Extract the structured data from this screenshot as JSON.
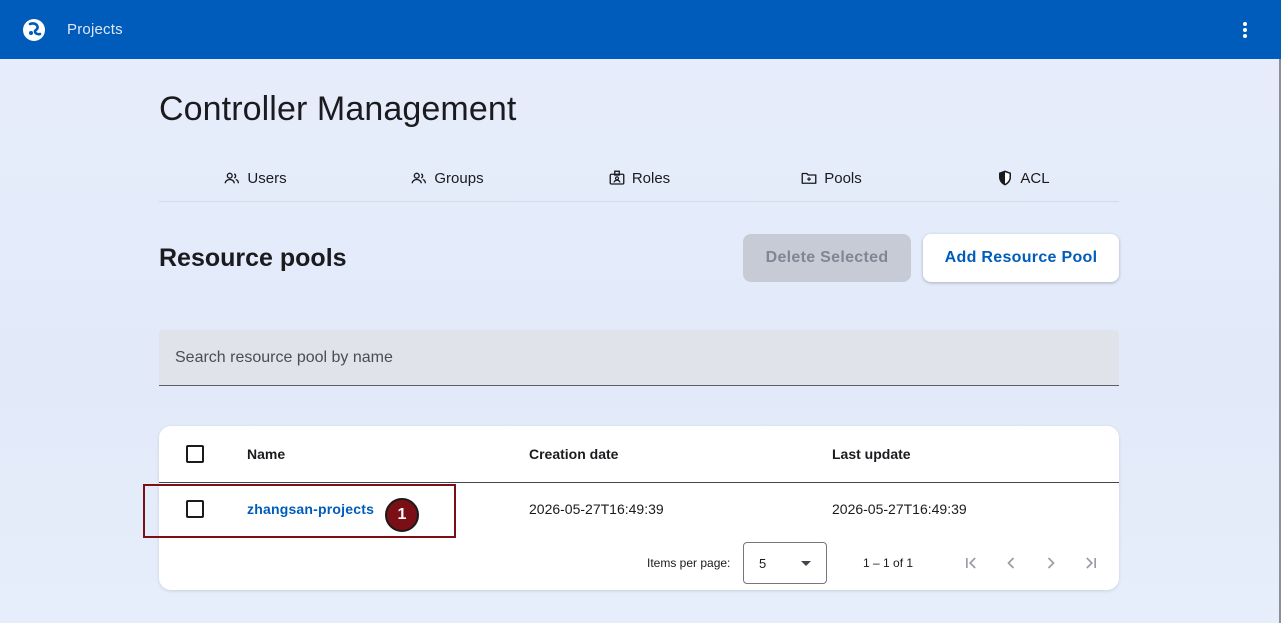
{
  "app": {
    "title": "Projects"
  },
  "page": {
    "title": "Controller Management"
  },
  "tabs": [
    {
      "label": "Users",
      "icon": "users-icon"
    },
    {
      "label": "Groups",
      "icon": "groups-icon"
    },
    {
      "label": "Roles",
      "icon": "roles-icon"
    },
    {
      "label": "Pools",
      "icon": "folder-icon"
    },
    {
      "label": "ACL",
      "icon": "shield-icon"
    }
  ],
  "section": {
    "title": "Resource pools",
    "delete_label": "Delete Selected",
    "add_label": "Add Resource Pool"
  },
  "search": {
    "placeholder": "Search resource pool by name",
    "value": ""
  },
  "table": {
    "columns": [
      "Name",
      "Creation date",
      "Last update"
    ],
    "rows": [
      {
        "name": "zhangsan-projects",
        "created": "2026-05-27T16:49:39",
        "updated": "2026-05-27T16:49:39"
      }
    ]
  },
  "paginator": {
    "items_per_page_label": "Items per page:",
    "items_per_page": "5",
    "range": "1 – 1 of 1"
  },
  "annotation": {
    "marker": "1"
  },
  "colors": {
    "primary": "#005cbb",
    "marker": "#7a1016"
  }
}
